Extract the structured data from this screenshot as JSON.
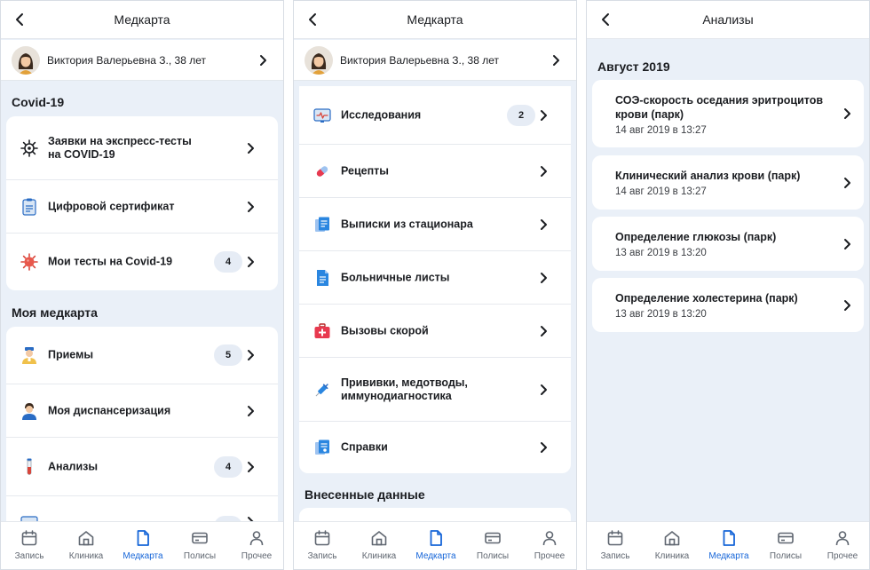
{
  "screens": [
    {
      "header": {
        "title": "Медкарта"
      },
      "user": {
        "name": "Виктория Валерьевна З., 38 лет"
      },
      "sections": [
        {
          "title": "Covid-19",
          "items": [
            {
              "label": "Заявки на экспресс-тесты на COVID-19",
              "icon": "virus-gear-icon"
            },
            {
              "label": "Цифровой сертификат",
              "icon": "clipboard-icon"
            },
            {
              "label": "Мои тесты на Covid-19",
              "icon": "virus-icon",
              "badge": "4"
            }
          ]
        },
        {
          "title": "Моя медкарта",
          "items": [
            {
              "label": "Приемы",
              "icon": "doctor-icon",
              "badge": "5"
            },
            {
              "label": "Моя диспансеризация",
              "icon": "patient-icon"
            },
            {
              "label": "Анализы",
              "icon": "test-tube-icon",
              "badge": "4"
            }
          ]
        }
      ]
    },
    {
      "header": {
        "title": "Медкарта"
      },
      "user": {
        "name": "Виктория Валерьевна З., 38 лет"
      },
      "items": [
        {
          "label": "Исследования",
          "icon": "monitor-icon",
          "badge": "2"
        },
        {
          "label": "Рецепты",
          "icon": "pill-icon"
        },
        {
          "label": "Выписки из стационара",
          "icon": "documents-icon"
        },
        {
          "label": "Больничные листы",
          "icon": "document-icon"
        },
        {
          "label": "Вызовы скорой",
          "icon": "first-aid-icon"
        },
        {
          "label": "Прививки, медотводы, иммунодиагностика",
          "icon": "syringe-icon"
        },
        {
          "label": "Справки",
          "icon": "certificate-icon"
        }
      ],
      "section2_title": "Внесенные данные"
    },
    {
      "header": {
        "title": "Анализы"
      },
      "month": "Август 2019",
      "analyses": [
        {
          "title": "СОЭ-скорость оседания эритроцитов крови (парк)",
          "date": "14 авг 2019 в 13:27"
        },
        {
          "title": "Клинический анализ крови (парк)",
          "date": "14 авг 2019 в 13:27"
        },
        {
          "title": "Определение глюкозы (парк)",
          "date": "13 авг 2019 в 13:20"
        },
        {
          "title": "Определение холестерина (парк)",
          "date": "13 авг 2019 в 13:20"
        }
      ]
    }
  ],
  "tabbar": [
    {
      "label": "Запись",
      "icon": "calendar-icon"
    },
    {
      "label": "Клиника",
      "icon": "clinic-icon"
    },
    {
      "label": "Медкарта",
      "icon": "medcard-icon",
      "active": true
    },
    {
      "label": "Полисы",
      "icon": "card-icon"
    },
    {
      "label": "Прочее",
      "icon": "person-icon"
    }
  ],
  "colors": {
    "accent": "#1565d8",
    "background": "#eaf0f8",
    "badge": "#e6ecf5"
  }
}
